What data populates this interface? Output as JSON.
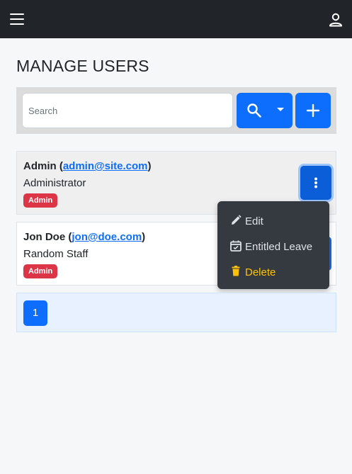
{
  "page": {
    "title": "MANAGE USERS"
  },
  "search": {
    "placeholder": "Search",
    "value": ""
  },
  "users": [
    {
      "name": "Admin",
      "email": "admin@site.com",
      "role": "Administrator",
      "badge": "Admin"
    },
    {
      "name": "Jon Doe",
      "email": "jon@doe.com",
      "role": "Random Staff",
      "badge": "Admin"
    }
  ],
  "dropdown": {
    "items": [
      {
        "label": "Edit",
        "icon": "pencil-icon"
      },
      {
        "label": "Entitled Leave",
        "icon": "calendar-check-icon"
      },
      {
        "label": "Delete",
        "icon": "trash-icon"
      }
    ]
  },
  "pagination": {
    "pages": [
      "1"
    ],
    "current": "1"
  },
  "colors": {
    "topbar": "#212529",
    "primary": "#0d6efd",
    "badge": "#dc3545",
    "danger_text": "#ffc107",
    "dropdown_bg": "#343a40"
  }
}
